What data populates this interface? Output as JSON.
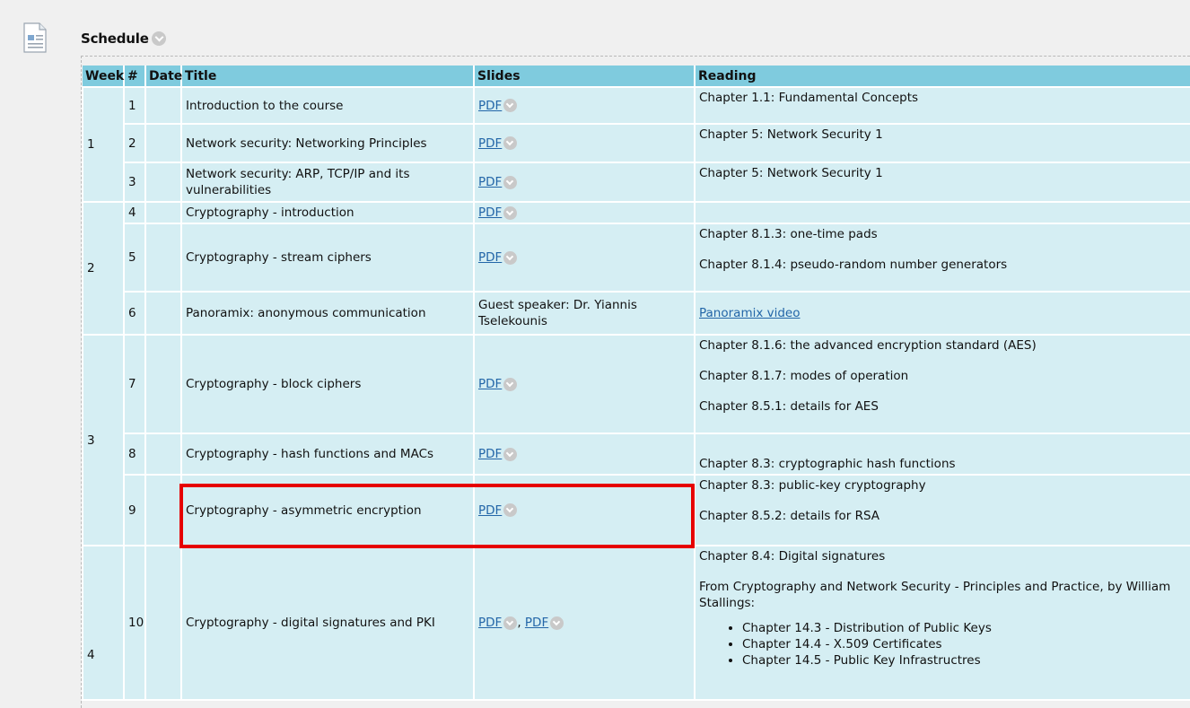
{
  "heading": "Schedule",
  "columns": {
    "week": "Week",
    "num": "#",
    "date": "Date",
    "title": "Title",
    "slides": "Slides",
    "reading": "Reading"
  },
  "weeks": [
    "1",
    "2",
    "3",
    "4"
  ],
  "rows": [
    {
      "num": "1",
      "title": "Introduction to the course",
      "slides": [
        "PDF"
      ],
      "reading": [
        "Chapter 1.1: Fundamental Concepts"
      ]
    },
    {
      "num": "2",
      "title": "Network security: Networking Principles",
      "slides": [
        "PDF"
      ],
      "reading": [
        "Chapter 5: Network Security 1"
      ]
    },
    {
      "num": "3",
      "title": "Network security: ARP, TCP/IP and its vulnerabilities",
      "slides": [
        "PDF"
      ],
      "reading": [
        "Chapter 5: Network Security 1"
      ]
    },
    {
      "num": "4",
      "title": "Cryptography - introduction",
      "slides": [
        "PDF"
      ],
      "reading": []
    },
    {
      "num": "5",
      "title": "Cryptography - stream ciphers",
      "slides": [
        "PDF"
      ],
      "reading": [
        "Chapter 8.1.3: one-time pads",
        "Chapter 8.1.4: pseudo-random number generators"
      ]
    },
    {
      "num": "6",
      "title": "Panoramix: anonymous communication",
      "slides_text": "Guest speaker: Dr. Yiannis Tselekounis",
      "reading_link": "Panoramix video"
    },
    {
      "num": "7",
      "title": "Cryptography - block ciphers",
      "slides": [
        "PDF"
      ],
      "reading": [
        "Chapter 8.1.6: the advanced encryption standard (AES)",
        "Chapter 8.1.7: modes of operation",
        "Chapter 8.5.1: details for AES"
      ]
    },
    {
      "num": "8",
      "title": "Cryptography - hash functions and MACs",
      "slides": [
        "PDF"
      ],
      "reading": [
        "Chapter 8.3: cryptographic hash functions"
      ]
    },
    {
      "num": "9",
      "title": "Cryptography - asymmetric encryption",
      "slides": [
        "PDF"
      ],
      "reading": [
        "Chapter 8.3: public-key cryptography",
        "Chapter 8.5.2: details for RSA"
      ]
    },
    {
      "num": "10",
      "title": "Cryptography - digital signatures and PKI",
      "slides": [
        "PDF",
        ", ",
        "PDF"
      ],
      "reading": [
        "Chapter 8.4: Digital signatures",
        "From Cryptography and Network Security - Principles and Practice, by William Stallings:"
      ],
      "reading_list": [
        "Chapter 14.3 - Distribution of Public Keys",
        "Chapter 14.4 - X.509 Certificates",
        "Chapter 14.5 - Public Key Infrastructres"
      ]
    }
  ],
  "colors": {
    "header": "#7fcbde",
    "cell": "#d5eef3",
    "link": "#2366a8",
    "highlight": "#e60000"
  }
}
